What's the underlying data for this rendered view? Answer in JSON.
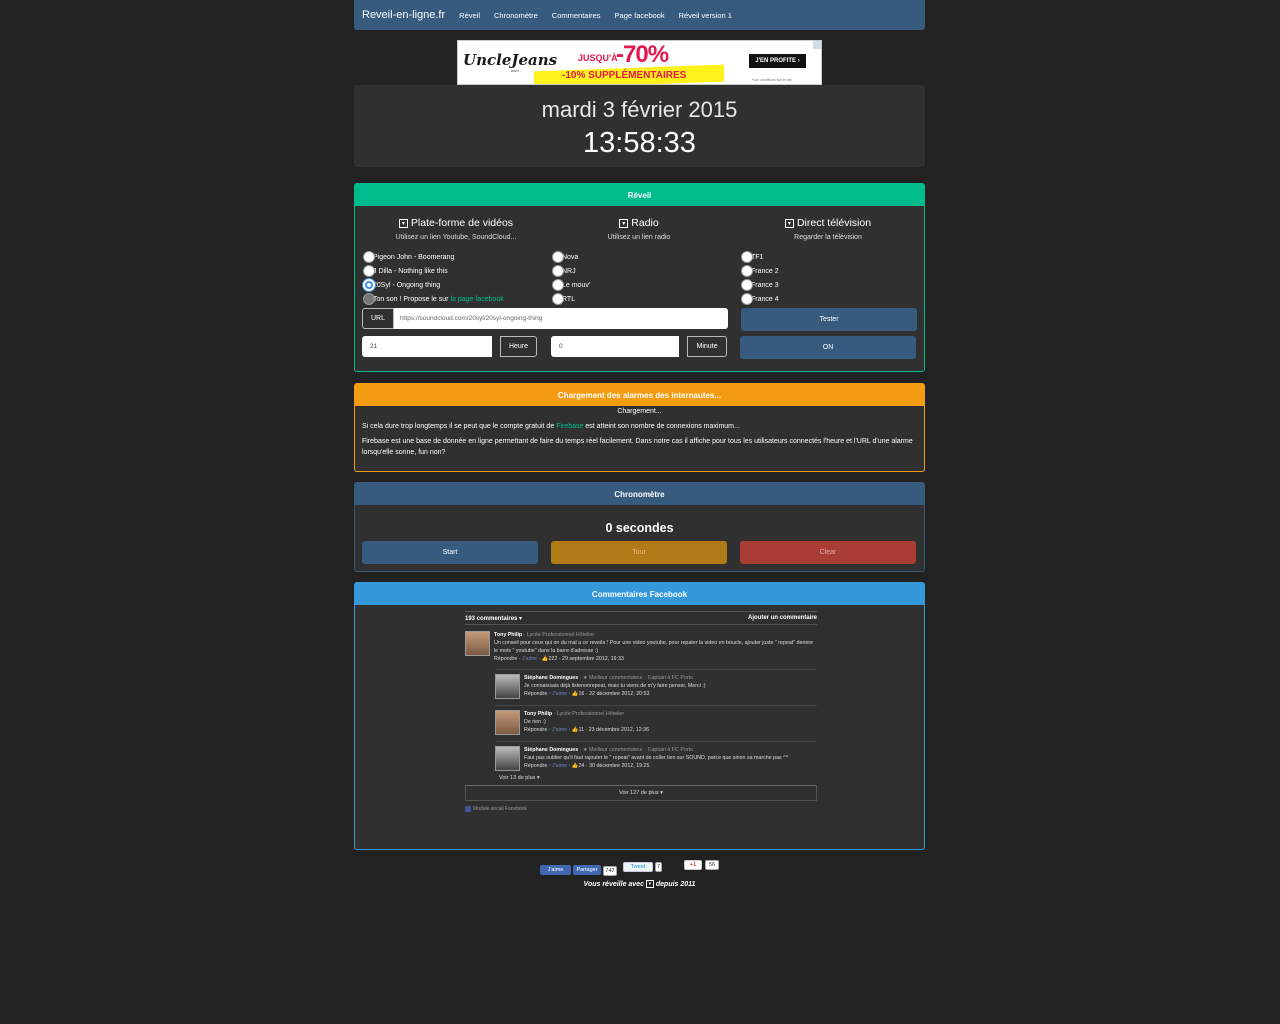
{
  "navbar": {
    "brand": "Reveil-en-ligne.fr",
    "links": [
      "Réveil",
      "Chronomètre",
      "Commentaires",
      "Page facebook",
      "Réveil version 1"
    ]
  },
  "ad": {
    "logo": "UncleJeans",
    "logo_sub": ".com",
    "up_to": "JUSQU'À",
    "percent": "-70%",
    "extra": "-10% SUPPLÉMENTAIRES",
    "cta": "J'EN PROFITE ›",
    "fine": "*voir conditions sur le site"
  },
  "clock": {
    "date": "mardi 3 février 2015",
    "time": "13:58:33"
  },
  "reveil": {
    "title": "Réveil",
    "cols": [
      {
        "title": "Plate-forme de vidéos",
        "sub": "Utilisez un lien Youtube, SoundCloud...",
        "icon": "tv-icon",
        "options": [
          "Pigeon John - Boomerang",
          "J Dilla - Nothing like this",
          "20Syl - Ongoing thing",
          "Ton son ! Propose le sur"
        ],
        "link": "la page facebook"
      },
      {
        "title": "Radio",
        "sub": "Utilisez un lien radio",
        "icon": "tv-icon",
        "options": [
          "Nova",
          "NRJ",
          "Le mouv'",
          "RTL"
        ]
      },
      {
        "title": "Direct télévision",
        "sub": "Regarder la télévision",
        "icon": "tv-icon",
        "options": [
          "TF1",
          "France 2",
          "France 3",
          "France 4"
        ]
      }
    ],
    "url_label": "URL",
    "url_value": "https://soundcloud.com/20syl/20syl-ongoing-thing",
    "tester": "Tester",
    "hour_value": "21",
    "hour_label": "Heure",
    "minute_value": "0",
    "minute_label": "Minute",
    "on": "ON"
  },
  "chargement": {
    "title": "Chargement des alarmes des internautes...",
    "status": "Chargement...",
    "p1_a": "Si cela dure trop longtemps il se peut que le compte gratuit de",
    "p1_link": "Firebase",
    "p1_b": "est atteint son nombre de connexions maximum...",
    "p2": "Firebase est une base de donnée en ligne permettant de faire du temps réel facilement. Dans notre cas il affiche pour tous les utilisateurs connectés l'heure et l'URL d'une alarme lorsqu'elle sonne, fun non?"
  },
  "chrono": {
    "title": "Chronomètre",
    "value": "0 secondes",
    "start": "Start",
    "tour": "Tour",
    "clear": "Clear"
  },
  "facebook": {
    "title": "Commentaires Facebook",
    "count": "193 commentaires ▾",
    "add": "Ajouter un commentaire",
    "comments": [
      {
        "name": "Tony Philip",
        "meta": " · Lycée Professionnel Hôtelier",
        "text": "Un conseil pour ceux qui on du mal a ce reveila ! Pour une video youtube, pour repater la video en boucle, ajouter juste \" repeat\" deriere le mots \" youtube\" dans la barre d'adresse :)",
        "reply": "Répondre",
        "like": "J'aime",
        "likes": "222",
        "date": "29 septembre 2012, 19:33"
      },
      {
        "name": "Stéphane Domingues",
        "meta": " · ★ Meilleur commentateur · Captain à FC Porto",
        "text": "Je connaissais déjà listenonrepeat, mais tu viens de m'y faire penser, Merci :)",
        "reply": "Répondre",
        "like": "J'aime",
        "likes": "16",
        "date": "22 décembre 2012, 20:53"
      },
      {
        "name": "Tony Philip",
        "meta": " · Lycée Professionnel Hôtelier",
        "text": "De rien :)",
        "reply": "Répondre",
        "like": "J'aime",
        "likes": "11",
        "date": "23 décembre 2012, 12:36"
      },
      {
        "name": "Stéphane Domingues",
        "meta": " · ★ Meilleur commentateur · Captain à FC Porto",
        "text": "Faut pas oublier qu'il faut rajouter le \" repeat\" avant de coller lien sur SOUND, parce que sinon sa marche pas ^^",
        "reply": "Répondre",
        "like": "J'aime",
        "likes": "24",
        "date": "30 décembre 2012, 19:25"
      }
    ],
    "more_small": "Voir 13 de plus ▾",
    "more_big": "Voir 127 de plus ▾",
    "plugin": "Module social Facebook"
  },
  "social": {
    "fb_like": "J'aime",
    "fb_share": "Partager",
    "fb_count": "747",
    "tweet": "Tweet",
    "tweet_count": "7",
    "gplus": "+1",
    "gplus_count": "56"
  },
  "footer": {
    "a": "Vous réveille avec",
    "b": "depuis 2011"
  }
}
